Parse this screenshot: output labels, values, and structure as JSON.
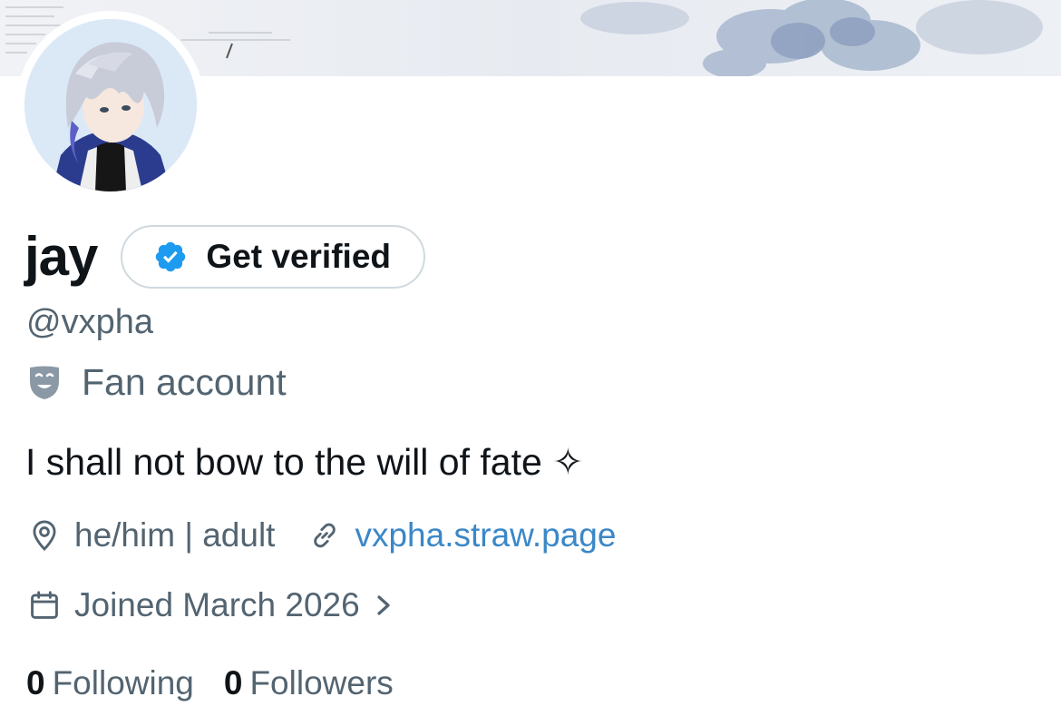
{
  "profile": {
    "display_name": "jay",
    "handle": "@vxpha",
    "category": "Fan account",
    "bio": "I shall not bow to the will of fate ✧",
    "location": "he/him | adult",
    "website": "vxpha.straw.page",
    "joined": "Joined March 2026"
  },
  "verify_button": {
    "label": "Get verified"
  },
  "stats": {
    "following_count": "0",
    "following_label": "Following",
    "followers_count": "0",
    "followers_label": "Followers"
  },
  "colors": {
    "text_primary": "#0f1419",
    "text_secondary": "#536471",
    "link": "#3b87c8",
    "verified_badge": "#1d9bf0",
    "button_border": "#cfd9de"
  },
  "icons": {
    "verified": "verified-badge-icon",
    "category": "theater-mask-icon",
    "location": "location-pin-icon",
    "website": "link-icon",
    "joined": "calendar-icon",
    "joined_more": "chevron-right-icon"
  }
}
